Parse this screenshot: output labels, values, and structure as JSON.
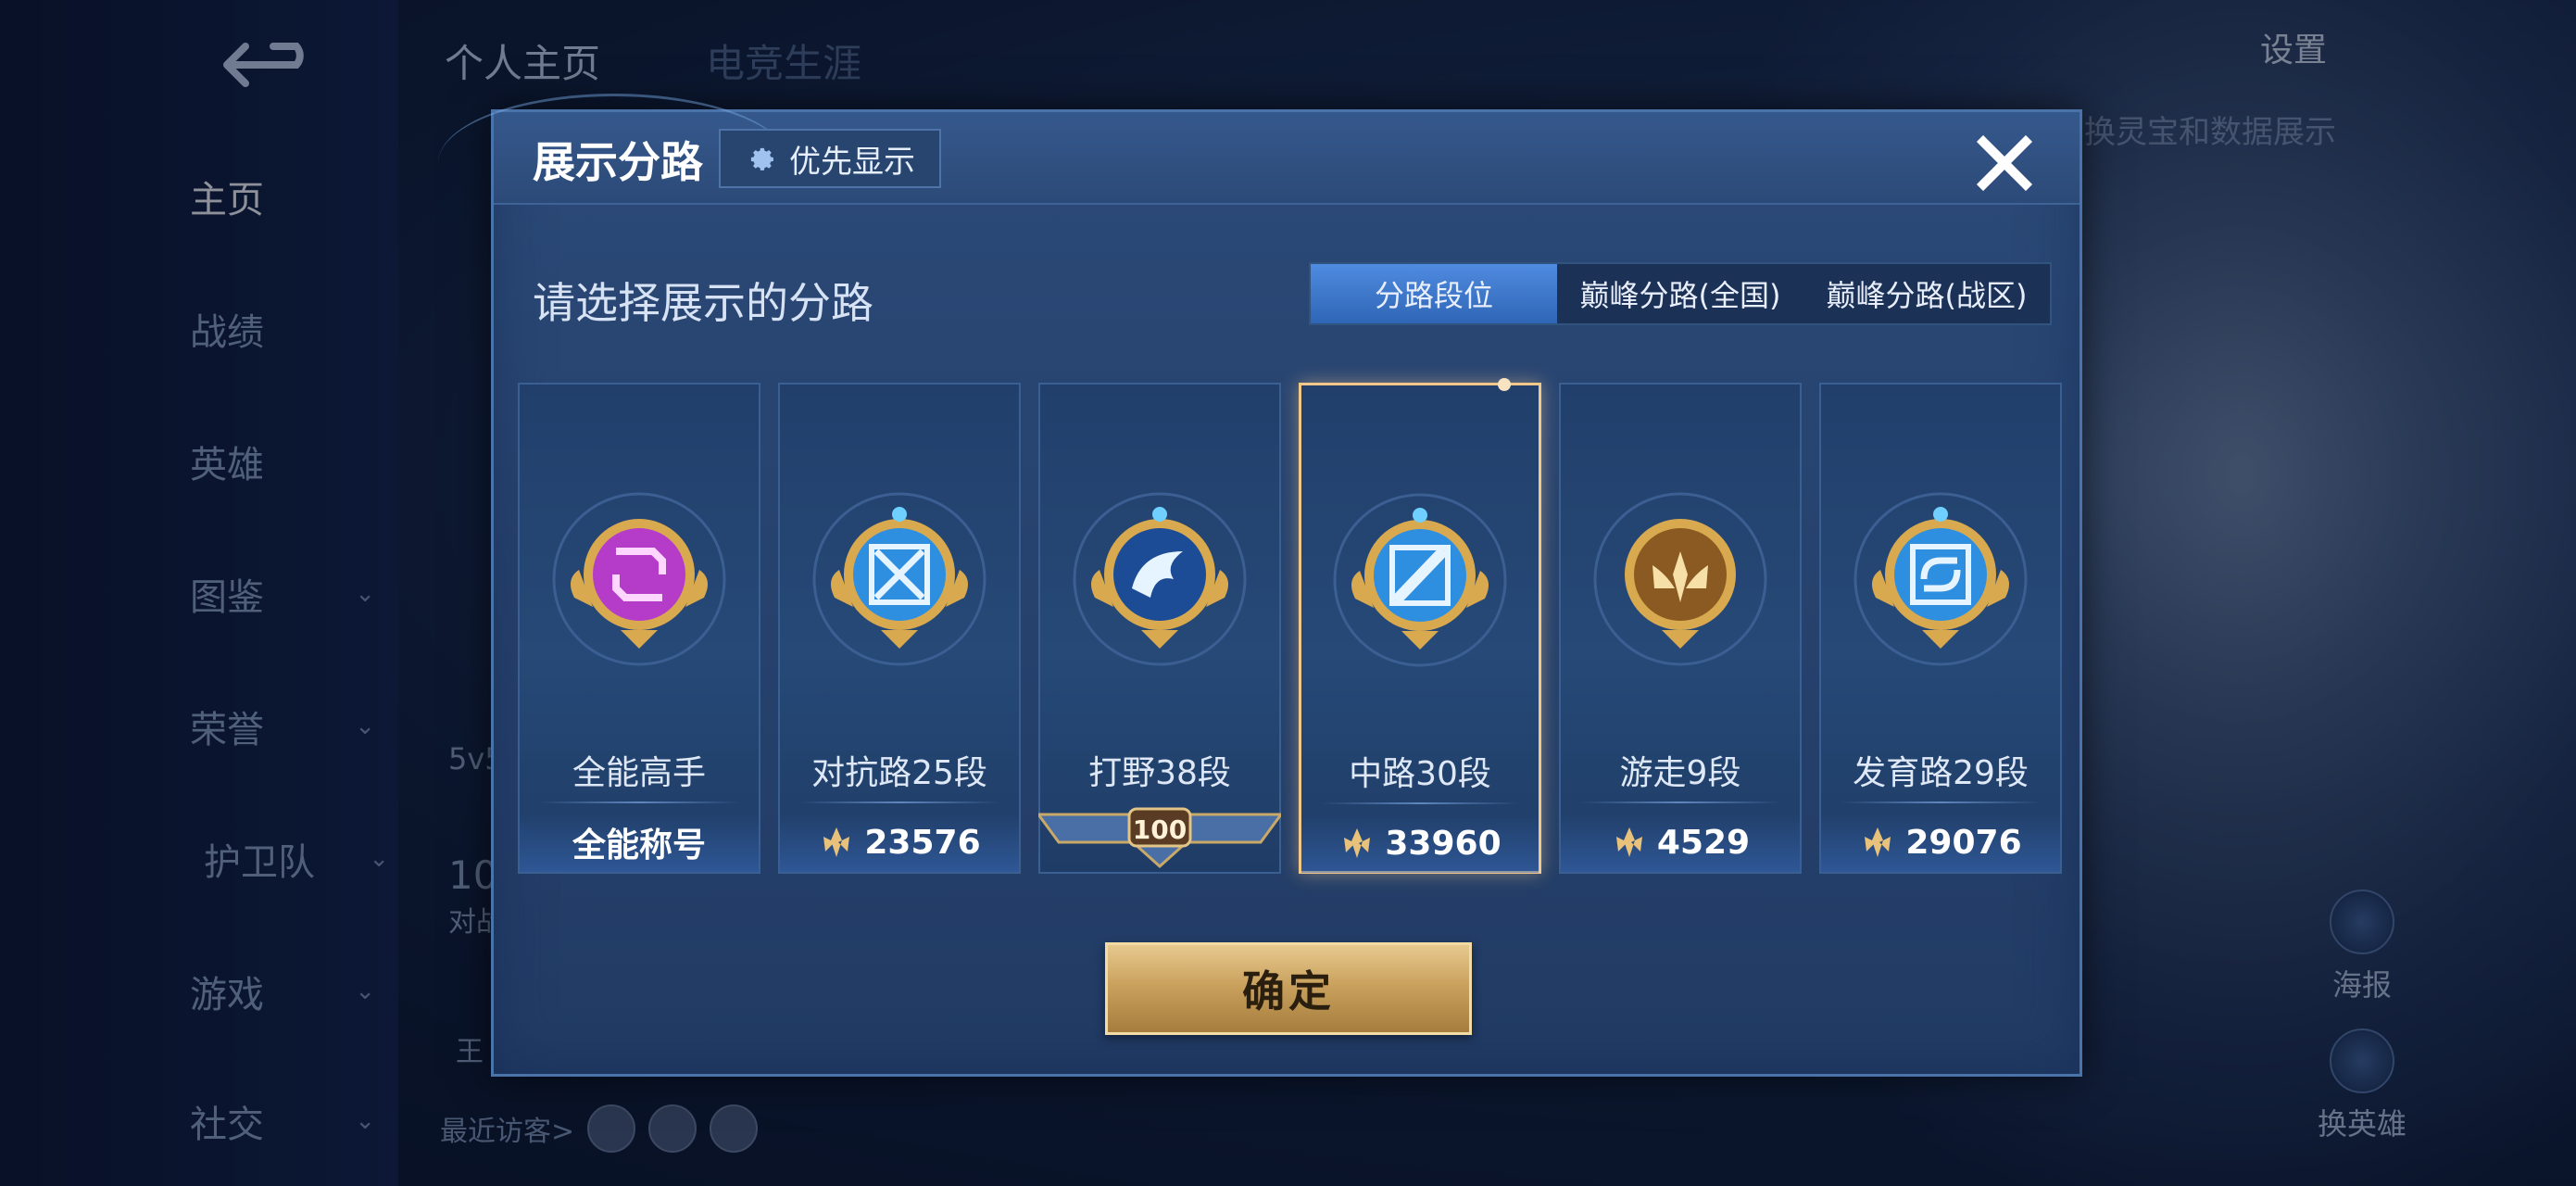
{
  "background": {
    "back_icon": "back-arrow-icon",
    "top_tabs": [
      "个人主页",
      "电竞生涯"
    ],
    "nav_items": [
      {
        "label": "主页",
        "has_chevron": false,
        "active": true
      },
      {
        "label": "战绩",
        "has_chevron": false
      },
      {
        "label": "英雄",
        "has_chevron": false
      },
      {
        "label": "图鉴",
        "has_chevron": true
      },
      {
        "label": "荣誉",
        "has_chevron": true
      },
      {
        "label": "护卫队",
        "has_chevron": true
      },
      {
        "label": "游戏",
        "has_chevron": true
      },
      {
        "label": "社交",
        "has_chevron": true
      }
    ],
    "settings_label": "设置",
    "hint_text": "换灵宝和数据展示",
    "poster_label": "海报",
    "change_hero_label": "换英雄",
    "recent_visitors_label": "最近访客>",
    "partial_texts": [
      "5v5",
      "10",
      "对战",
      "王"
    ]
  },
  "modal": {
    "title": "展示分路",
    "priority_button": {
      "icon": "gear-icon",
      "label": "优先显示"
    },
    "close_icon": "close-icon",
    "subtitle": "请选择展示的分路",
    "tabs": [
      {
        "label": "分路段位",
        "active": true
      },
      {
        "label": "巅峰分路(全国)",
        "active": false
      },
      {
        "label": "巅峰分路(战区)",
        "active": false
      }
    ],
    "cards": [
      {
        "name": "全能高手",
        "value": "全能称号",
        "value_icon": "",
        "badge": "all-round-badge",
        "accent": "#b53cc8",
        "selected": false
      },
      {
        "name": "对抗路25段",
        "value": "23576",
        "value_icon": "power-icon",
        "badge": "clash-lane-badge",
        "accent": "#2e8fe0",
        "selected": false
      },
      {
        "name": "打野38段",
        "value": "100",
        "value_icon": "rank-banner",
        "badge": "jungle-badge",
        "accent": "#2b6fc8",
        "selected": false
      },
      {
        "name": "中路30段",
        "value": "33960",
        "value_icon": "power-icon",
        "badge": "mid-lane-badge",
        "accent": "#2e8fe0",
        "selected": true
      },
      {
        "name": "游走9段",
        "value": "4529",
        "value_icon": "power-icon",
        "badge": "roam-badge",
        "accent": "#c98a2e",
        "selected": false
      },
      {
        "name": "发育路29段",
        "value": "29076",
        "value_icon": "power-icon",
        "badge": "farm-lane-badge",
        "accent": "#2e8fe0",
        "selected": false
      }
    ],
    "confirm_label": "确定"
  },
  "colors": {
    "gold": "#f1c88a",
    "active_tab": "#3f7fd6",
    "modal_bg": "#27436f"
  }
}
